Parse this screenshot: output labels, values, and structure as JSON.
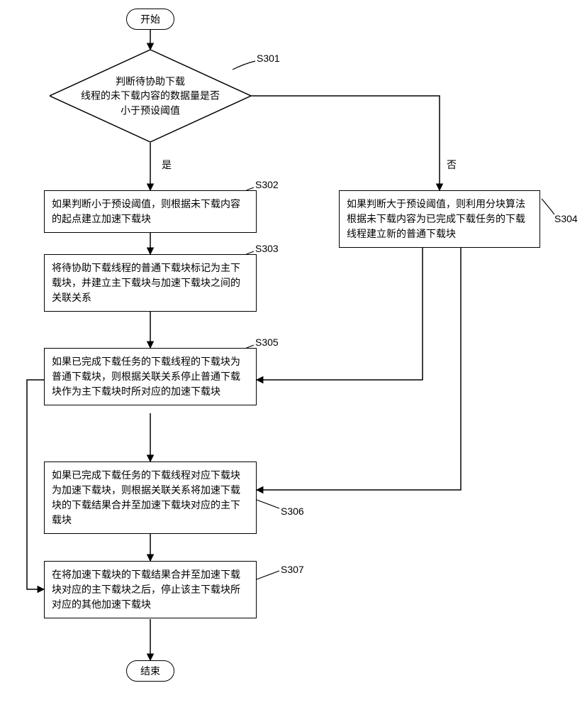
{
  "chart_data": {
    "type": "flowchart",
    "nodes": [
      {
        "id": "start",
        "kind": "terminator",
        "label": "开始"
      },
      {
        "id": "S301",
        "kind": "decision",
        "label": "判断待协助下载线程的未下载内容的数据量是否小于预设阈值"
      },
      {
        "id": "S302",
        "kind": "process",
        "label": "如果判断小于预设阈值，则根据未下载内容的起点建立加速下载块"
      },
      {
        "id": "S303",
        "kind": "process",
        "label": "将待协助下载线程的普通下载块标记为主下载块，并建立主下载块与加速下载块之间的关联关系"
      },
      {
        "id": "S304",
        "kind": "process",
        "label": "如果判断大于预设阈值，则利用分块算法根据未下载内容为已完成下载任务的下载线程建立新的普通下载块"
      },
      {
        "id": "S305",
        "kind": "process",
        "label": "如果已完成下载任务的下载线程的下载块为普通下载块，则根据关联关系停止普通下载块作为主下载块时所对应的加速下载块"
      },
      {
        "id": "S306",
        "kind": "process",
        "label": "如果已完成下载任务的下载线程对应下载块为加速下载块，则根据关联关系将加速下载块的下载结果合并至加速下载块对应的主下载块"
      },
      {
        "id": "S307",
        "kind": "process",
        "label": "在将加速下载块的下载结果合并至加速下载块对应的主下载块之后，停止该主下载块所对应的其他加速下载块"
      },
      {
        "id": "end",
        "kind": "terminator",
        "label": "结束"
      }
    ],
    "edges": [
      {
        "from": "start",
        "to": "S301"
      },
      {
        "from": "S301",
        "to": "S302",
        "label": "是"
      },
      {
        "from": "S301",
        "to": "S304",
        "label": "否"
      },
      {
        "from": "S302",
        "to": "S303"
      },
      {
        "from": "S303",
        "to": "S305"
      },
      {
        "from": "S304",
        "to": "S305"
      },
      {
        "from": "S304",
        "to": "S306"
      },
      {
        "from": "S305",
        "to": "S306"
      },
      {
        "from": "S305",
        "to": "S307",
        "note": "loop-left"
      },
      {
        "from": "S306",
        "to": "S307"
      },
      {
        "from": "S307",
        "to": "end"
      }
    ]
  },
  "nodes": {
    "start": "开始",
    "end": "结束",
    "s301_line1": "判断待协助下载",
    "s301_line2": "线程的未下载内容的数据量是否",
    "s301_line3": "小于预设阈值",
    "s302": "如果判断小于预设阈值，则根据未下载内容的起点建立加速下载块",
    "s303": "将待协助下载线程的普通下载块标记为主下载块，并建立主下载块与加速下载块之间的关联关系",
    "s304": "如果判断大于预设阈值，则利用分块算法根据未下载内容为已完成下载任务的下载线程建立新的普通下载块",
    "s305": "如果已完成下载任务的下载线程的下载块为普通下载块，则根据关联关系停止普通下载块作为主下载块时所对应的加速下载块",
    "s306": "如果已完成下载任务的下载线程对应下载块为加速下载块，则根据关联关系将加速下载块的下载结果合并至加速下载块对应的主下载块",
    "s307": "在将加速下载块的下载结果合并至加速下载块对应的主下载块之后，停止该主下载块所对应的其他加速下载块"
  },
  "labels": {
    "yes": "是",
    "no": "否"
  },
  "ids": {
    "s301": "S301",
    "s302": "S302",
    "s303": "S303",
    "s304": "S304",
    "s305": "S305",
    "s306": "S306",
    "s307": "S307"
  }
}
